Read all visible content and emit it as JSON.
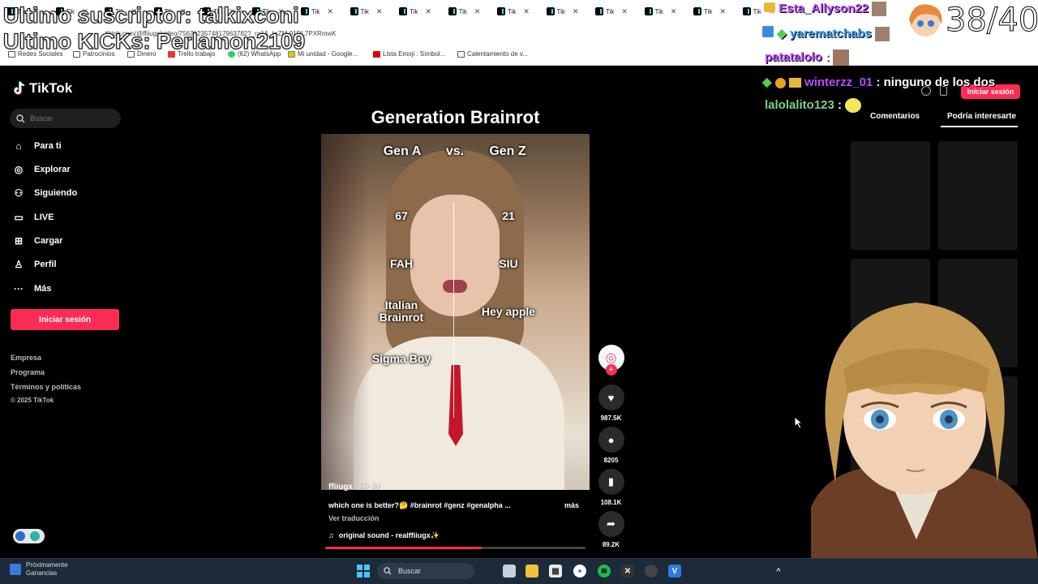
{
  "browser": {
    "tab_labels": [
      "Tik",
      "Tik",
      "Tik",
      "Tik",
      "Tik",
      "Tik",
      "Tik",
      "Tik",
      "Tik",
      "Tik",
      "Tik",
      "Tik",
      "Tik",
      "Tik",
      "Tik",
      "Tik"
    ],
    "url": "tiktok.com/@ffiiugx/video/7567123574817963782?_r=1&_t=ZM-91DL7PXRmwK",
    "bookmarks": [
      "Redes Sociales",
      "Patrocinios",
      "Dinero",
      "Trello trabajo",
      "(62) WhatsApp",
      "Mi unidad - Google...",
      "Lista Emoji : Símbol...",
      "Calentamiento de v..."
    ]
  },
  "overlay": {
    "last_subscriber": "Ultimo suscriptor: talkixconi",
    "last_kicks": "Ultimo KICKs: Perlamon2109",
    "counter": "38/40",
    "chat": [
      {
        "user": "Esta_Allyson22",
        "message": "",
        "color": "#b84bff"
      },
      {
        "user": "yarematchabs",
        "message": "",
        "color": "#1e90ff"
      },
      {
        "user": "patatalolo",
        "message": "",
        "color": "#b84bff"
      },
      {
        "user": "winterzz_01",
        "message": "ninguno de los dos",
        "color": "#b84bff"
      },
      {
        "user": "lalolalito123",
        "message": "",
        "color": "#7cd18a"
      }
    ]
  },
  "tiktok": {
    "logo": "TikTok",
    "search_placeholder": "Buscar",
    "nav": [
      "Para ti",
      "Explorar",
      "Siguiendo",
      "LIVE",
      "Cargar",
      "Perfil",
      "Más"
    ],
    "login_button": "Iniciar sesión",
    "footer": [
      "Empresa",
      "Programa",
      "Términos y políticas",
      "© 2025 TikTok"
    ],
    "top_login": "Iniciar sesión",
    "right_tabs": [
      "Comentarios",
      "Podría interesarte"
    ],
    "video": {
      "title": "Generation Brainrot",
      "header_left": "Gen A",
      "header_vs": "vs.",
      "header_right": "Gen Z",
      "left_items": [
        "67",
        "FAH",
        "Italian\nBrainrot",
        "Sigma Boy"
      ],
      "right_items": [
        "21",
        "SIU",
        "Hey apple"
      ],
      "user": "ffiiugx",
      "date": " · 10-30",
      "caption": "which one is better?🤔 #brainrot #genz #genalpha ...",
      "more": "más",
      "translate": "Ver traducción",
      "sound": "original sound - realffiiugx✨",
      "progress": 0.6
    },
    "actions": {
      "likes": "987.5K",
      "comments": "8205",
      "saves": "108.1K",
      "shares": "89.2K"
    }
  },
  "taskbar": {
    "weather_line1": "Próximamente",
    "weather_line2": "Ganancias",
    "search": "Buscar"
  }
}
